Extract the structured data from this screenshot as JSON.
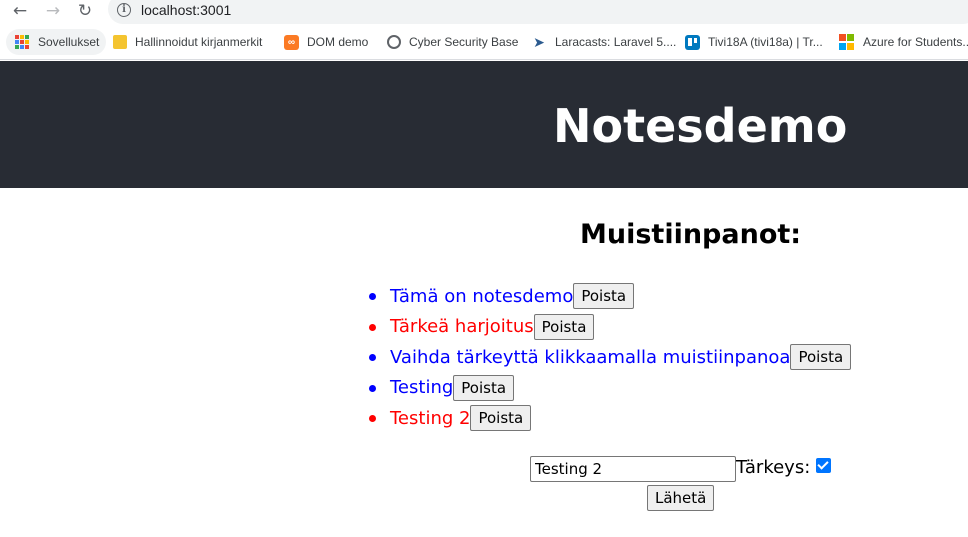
{
  "browser": {
    "url": "localhost:3001",
    "bookmarks": [
      {
        "label": "Sovellukset",
        "icon": "apps-grid-icon"
      },
      {
        "label": "Hallinnoidut kirjanmerkit",
        "icon": "folder-icon"
      },
      {
        "label": "DOM demo",
        "icon": "xampp-icon"
      },
      {
        "label": "Cyber Security Base",
        "icon": "globe-icon"
      },
      {
        "label": "Laracasts: Laravel 5....",
        "icon": "laracasts-icon"
      },
      {
        "label": "Tivi18A (tivi18a) | Tr...",
        "icon": "trello-icon"
      },
      {
        "label": "Azure for Students...",
        "icon": "microsoft-icon"
      }
    ]
  },
  "app": {
    "title": "Notesdemo",
    "notes_heading": "Muistiinpanot:",
    "delete_label": "Poista",
    "notes": [
      {
        "text": "Tämä on notesdemo",
        "important": false
      },
      {
        "text": "Tärkeä harjoitus",
        "important": true
      },
      {
        "text": "Vaihda tärkeyttä klikkaamalla muistiinpanoa",
        "important": false
      },
      {
        "text": "Testing",
        "important": false
      },
      {
        "text": "Testing 2",
        "important": true
      }
    ],
    "form": {
      "input_value": "Testing 2",
      "importance_label": "Tärkeys:",
      "importance_checked": true,
      "submit_label": "Lähetä"
    },
    "colors": {
      "header_bg": "#282c34",
      "normal_note": "#0000ff",
      "important_note": "#ff0000"
    }
  }
}
